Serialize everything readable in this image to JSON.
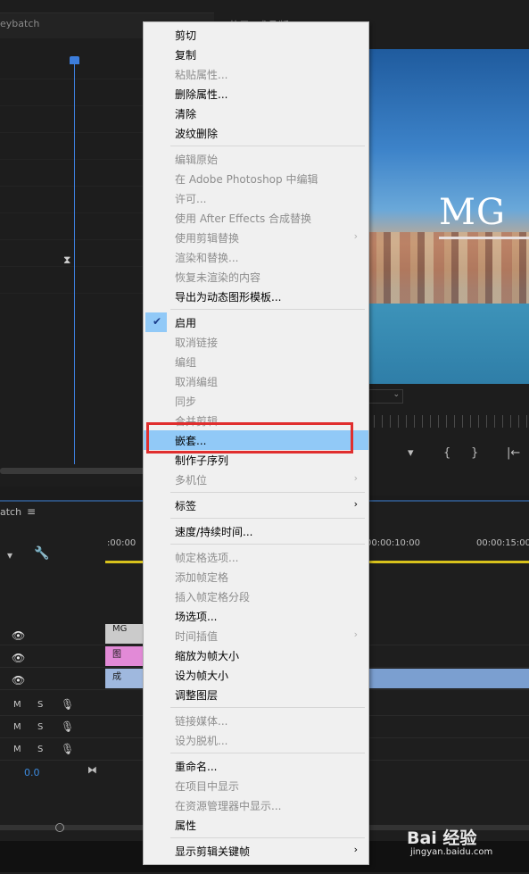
{
  "source": {
    "title": "eybatch"
  },
  "program": {
    "title": "节目: 成品版",
    "video_text": "MG",
    "dropdown": ""
  },
  "program_controls": [
    "▾",
    "{",
    "}",
    "|←"
  ],
  "timeline": {
    "title": "atch",
    "menu": "≡",
    "timecodes": [
      ":00:00",
      "00:00:10:00",
      "00:00:15:00"
    ],
    "volume": "0.0",
    "clips": {
      "v3": "MG",
      "v2": "图",
      "v1": "成"
    }
  },
  "context_menu": {
    "items": [
      {
        "label": "剪切",
        "disabled": false
      },
      {
        "label": "复制",
        "disabled": false
      },
      {
        "label": "粘贴属性...",
        "disabled": true
      },
      {
        "label": "删除属性...",
        "disabled": false
      },
      {
        "label": "清除",
        "disabled": false
      },
      {
        "label": "波纹删除",
        "disabled": false
      },
      {
        "label": "编辑原始",
        "disabled": true
      },
      {
        "label": "在 Adobe Photoshop 中编辑",
        "disabled": true
      },
      {
        "label": "许可...",
        "disabled": true
      },
      {
        "label": "使用 After Effects 合成替换",
        "disabled": true
      },
      {
        "label": "使用剪辑替换",
        "disabled": true,
        "submenu": true
      },
      {
        "label": "渲染和替换...",
        "disabled": true
      },
      {
        "label": "恢复未渲染的内容",
        "disabled": true
      },
      {
        "label": "导出为动态图形模板...",
        "disabled": false
      },
      {
        "label": "启用",
        "disabled": false,
        "checked": true
      },
      {
        "label": "取消链接",
        "disabled": true
      },
      {
        "label": "编组",
        "disabled": true
      },
      {
        "label": "取消编组",
        "disabled": true
      },
      {
        "label": "同步",
        "disabled": true
      },
      {
        "label": "合并剪辑",
        "disabled": true
      },
      {
        "label": "嵌套...",
        "disabled": false,
        "highlighted": true
      },
      {
        "label": "制作子序列",
        "disabled": false
      },
      {
        "label": "多机位",
        "disabled": true,
        "submenu": true
      },
      {
        "label": "标签",
        "disabled": false,
        "submenu": true
      },
      {
        "label": "速度/持续时间...",
        "disabled": false
      },
      {
        "label": "帧定格选项...",
        "disabled": true
      },
      {
        "label": "添加帧定格",
        "disabled": true
      },
      {
        "label": "插入帧定格分段",
        "disabled": true
      },
      {
        "label": "场选项...",
        "disabled": false
      },
      {
        "label": "时间插值",
        "disabled": true,
        "submenu": true
      },
      {
        "label": "缩放为帧大小",
        "disabled": false
      },
      {
        "label": "设为帧大小",
        "disabled": false
      },
      {
        "label": "调整图层",
        "disabled": false
      },
      {
        "label": "链接媒体...",
        "disabled": true
      },
      {
        "label": "设为脱机...",
        "disabled": true
      },
      {
        "label": "重命名...",
        "disabled": false
      },
      {
        "label": "在项目中显示",
        "disabled": true
      },
      {
        "label": "在资源管理器中显示...",
        "disabled": true
      },
      {
        "label": "属性",
        "disabled": false
      },
      {
        "label": "显示剪辑关键帧",
        "disabled": false,
        "submenu": true
      }
    ]
  },
  "watermark": {
    "main": "Bai 经验",
    "url": "jingyan.baidu.com"
  },
  "colors": {
    "highlight": "#91c9f7",
    "annotation_box": "#e02e2e",
    "playhead": "#3c7ddb",
    "work_area": "#d8c21c"
  }
}
